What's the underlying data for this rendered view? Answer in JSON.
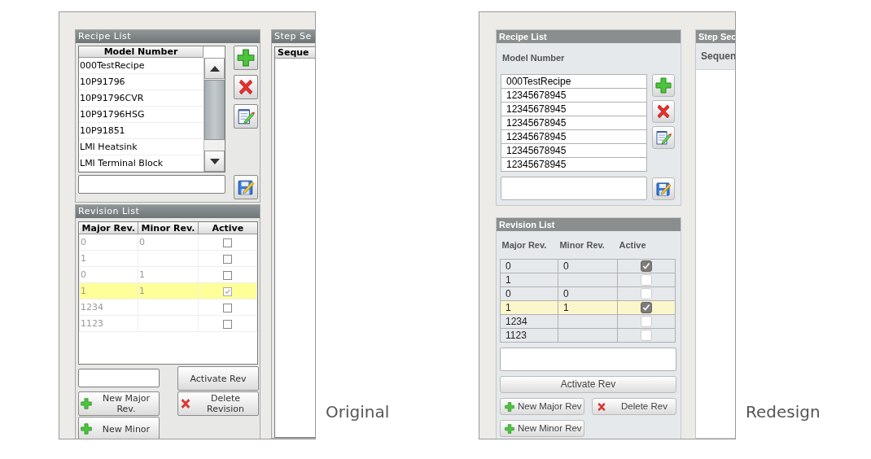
{
  "comparisons": [
    {
      "kind": "classic",
      "caption": "Original",
      "recipe_panel": {
        "title": "Recipe List",
        "column": "Model Number",
        "items": [
          "000TestRecipe",
          "10P91796",
          "10P91796CVR",
          "10P91796HSG",
          "10P91851",
          "LMI Heatsink",
          "LMI Terminal Block"
        ],
        "tools": [
          {
            "kind": "add"
          },
          {
            "kind": "delete"
          },
          {
            "kind": "edit"
          }
        ],
        "save": {
          "kind": "save"
        }
      },
      "step_panel": {
        "title": "Step Se",
        "column": "Seque"
      },
      "revision_panel": {
        "title": "Revision List",
        "columns": [
          "Major Rev.",
          "Minor Rev.",
          "Active"
        ],
        "rows": [
          {
            "major": "0",
            "minor": "0",
            "active": false,
            "selected": false
          },
          {
            "major": "1",
            "minor": "",
            "active": false,
            "selected": false
          },
          {
            "major": "0",
            "minor": "1",
            "active": false,
            "selected": false
          },
          {
            "major": "1",
            "minor": "1",
            "active": true,
            "selected": true
          },
          {
            "major": "1234",
            "minor": "",
            "active": false,
            "selected": false
          },
          {
            "major": "1123",
            "minor": "",
            "active": false,
            "selected": false
          }
        ],
        "controls": [
          {
            "kind": "field"
          },
          {
            "kind": "button",
            "label": "Activate Rev"
          },
          {
            "kind": "add",
            "label": "New Major Rev."
          },
          {
            "kind": "delete",
            "label": "Delete Revision"
          },
          {
            "kind": "add",
            "label": "New Minor"
          }
        ]
      }
    },
    {
      "kind": "modern",
      "caption": "Redesign",
      "recipe_panel": {
        "title": "Recipe List",
        "column": "Model Number",
        "items": [
          "000TestRecipe",
          "12345678945",
          "12345678945",
          "12345678945",
          "12345678945",
          "12345678945",
          "12345678945"
        ],
        "tools": [
          {
            "kind": "add"
          },
          {
            "kind": "delete"
          },
          {
            "kind": "edit"
          }
        ],
        "save": {
          "kind": "save"
        }
      },
      "step_panel": {
        "title": "Step Sec",
        "column": "Sequen"
      },
      "revision_panel": {
        "title": "Revision List",
        "columns": [
          "Major Rev.",
          "Minor Rev.",
          "Active"
        ],
        "rows": [
          {
            "major": "0",
            "minor": "0",
            "active": true,
            "selected": false
          },
          {
            "major": "1",
            "minor": "",
            "active": false,
            "selected": false
          },
          {
            "major": "0",
            "minor": "0",
            "active": false,
            "selected": false
          },
          {
            "major": "1",
            "minor": "1",
            "active": true,
            "selected": true
          },
          {
            "major": "1234",
            "minor": "",
            "active": false,
            "selected": false
          },
          {
            "major": "1123",
            "minor": "",
            "active": false,
            "selected": false
          }
        ],
        "controls": [
          {
            "kind": "field"
          },
          {
            "kind": "button",
            "label": "Activate Rev"
          },
          {
            "kind": "add",
            "label": "New Major Rev"
          },
          {
            "kind": "delete",
            "label": "Delete Rev"
          },
          {
            "kind": "add",
            "label": "New Minor Rev"
          }
        ]
      }
    }
  ]
}
